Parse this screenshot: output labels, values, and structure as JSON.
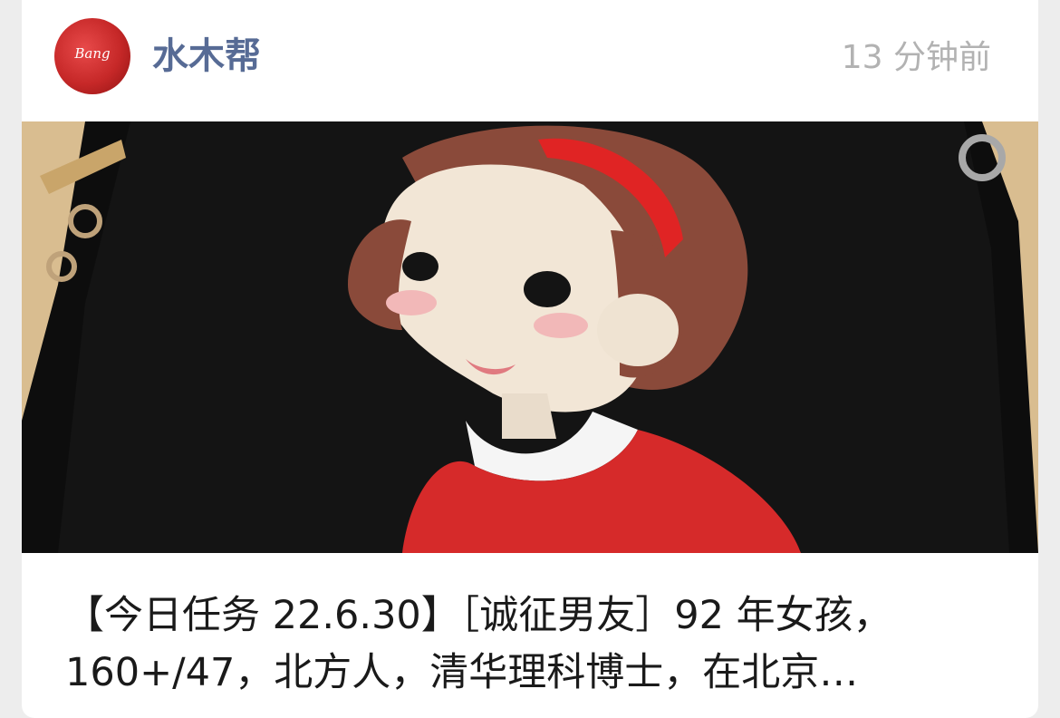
{
  "post": {
    "account_name": "水木帮",
    "avatar": {
      "icon": "bang-logo",
      "text": "Bang",
      "color": "#c62828"
    },
    "timestamp": "13 分钟前",
    "cover_image": {
      "icon": "cartoon-girl-handbag-image"
    },
    "caption_lines": [
      "【今日任务 22.6.30】［诚征男友］92 年女孩，",
      "160+/47，北方人，清华理科博士，在北京…"
    ],
    "colors": {
      "name": "#576b95",
      "time": "#b2b2b2",
      "text": "#1a1a1a"
    }
  }
}
